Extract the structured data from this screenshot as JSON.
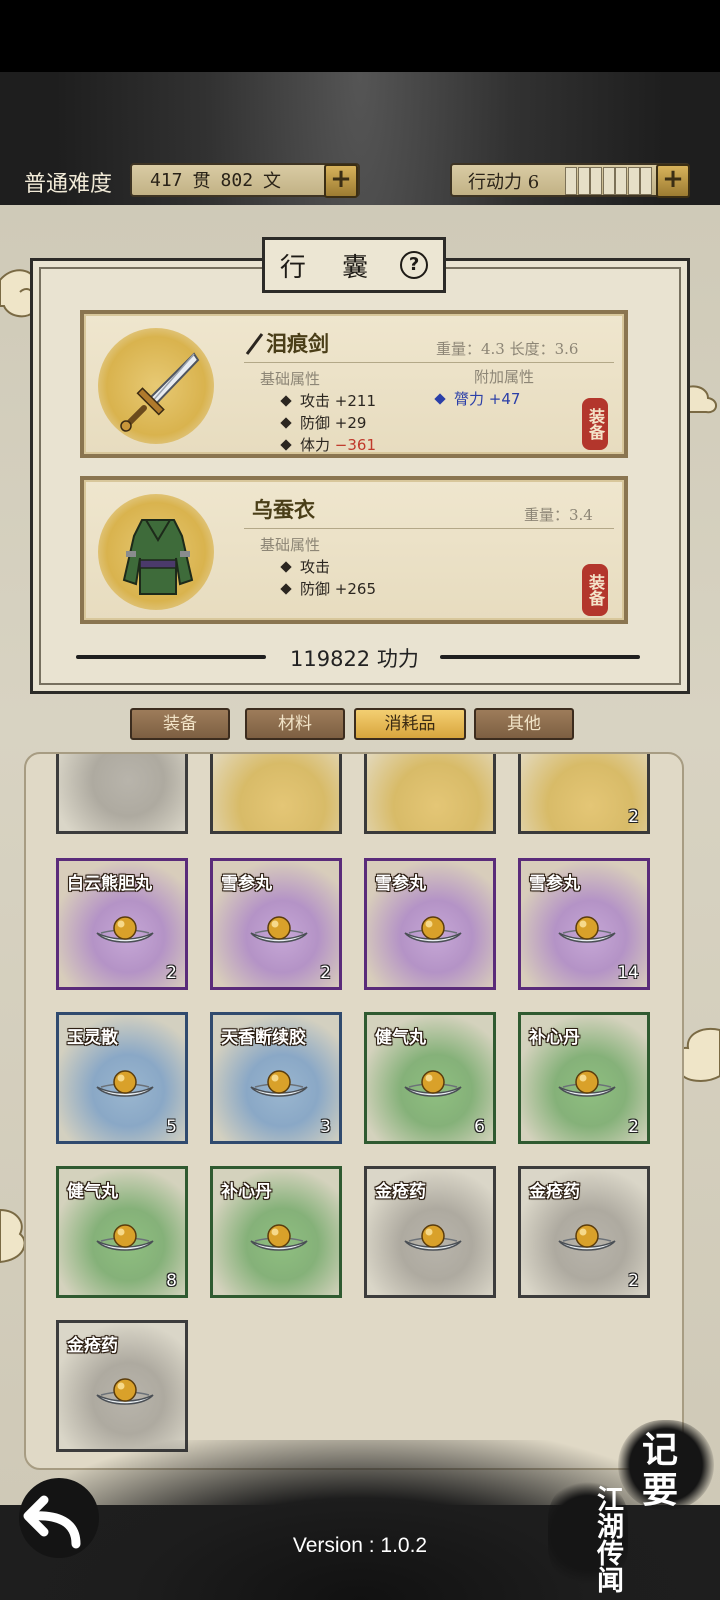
{
  "header": {
    "difficulty": "普通难度",
    "money_guan": "417",
    "money_guan_unit": "贯",
    "money_wen": "802",
    "money_wen_unit": "文",
    "stamina_label": "行动力 6",
    "stamina_pips": 7
  },
  "panel": {
    "title": "行 囊",
    "help": "?",
    "power": "119822 功力"
  },
  "equipment": [
    {
      "name": "泪痕剑",
      "stats_right": "重量：4.3  长度：3.6",
      "base_label": "基础属性",
      "extra_label": "附加属性",
      "base_attrs": [
        {
          "label": "攻击",
          "value": "+211"
        },
        {
          "label": "防御",
          "value": "+29"
        },
        {
          "label": "体力",
          "value": "−361"
        }
      ],
      "extra_attrs": [
        {
          "label": "膂力",
          "value": "+47"
        }
      ],
      "equip_label": "装备"
    },
    {
      "name": "乌蚕衣",
      "stats_right": "重量：3.4",
      "base_label": "基础属性",
      "base_attrs": [
        {
          "label": "攻击",
          "value": ""
        },
        {
          "label": "防御",
          "value": "+265"
        }
      ],
      "equip_label": "装备"
    }
  ],
  "tabs": [
    {
      "label": "装备",
      "active": false
    },
    {
      "label": "材料",
      "active": false
    },
    {
      "label": "消耗品",
      "active": true
    },
    {
      "label": "其他",
      "active": false
    }
  ],
  "items_partial_row": [
    {
      "name": "",
      "count": "",
      "color": "gray"
    },
    {
      "name": "",
      "count": "",
      "color": "gold"
    },
    {
      "name": "",
      "count": "",
      "color": "gold"
    },
    {
      "name": "",
      "count": "2",
      "color": "gold"
    }
  ],
  "items": [
    {
      "name": "白云熊胆丸",
      "count": "2",
      "color": "purple"
    },
    {
      "name": "雪参丸",
      "count": "2",
      "color": "purple"
    },
    {
      "name": "雪参丸",
      "count": "",
      "color": "purple"
    },
    {
      "name": "雪参丸",
      "count": "14",
      "color": "purple"
    },
    {
      "name": "玉灵散",
      "count": "5",
      "color": "blue"
    },
    {
      "name": "天香断续胶",
      "count": "3",
      "color": "blue"
    },
    {
      "name": "健气丸",
      "count": "6",
      "color": "green"
    },
    {
      "name": "补心丹",
      "count": "2",
      "color": "green"
    },
    {
      "name": "健气丸",
      "count": "8",
      "color": "green"
    },
    {
      "name": "补心丹",
      "count": "",
      "color": "green"
    },
    {
      "name": "金疮药",
      "count": "",
      "color": "gray"
    },
    {
      "name": "金疮药",
      "count": "2",
      "color": "gray"
    },
    {
      "name": "金疮药",
      "count": "",
      "color": "gray"
    }
  ],
  "side_buttons": {
    "notes": "记要",
    "rumors": "江湖传闻"
  },
  "version": "Version : 1.0.2",
  "colors": {
    "negative": "#c0392b",
    "extra_attr": "#2b3fa8"
  }
}
